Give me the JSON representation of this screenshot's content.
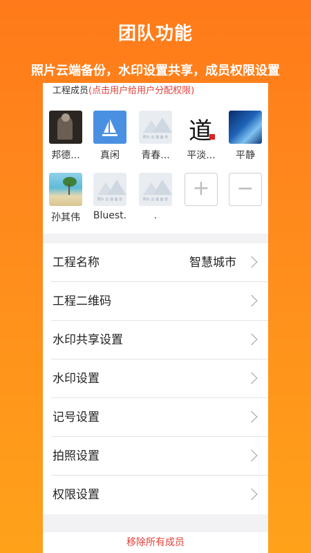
{
  "hero": {
    "title": "团队功能",
    "subtitle": "照片云端备份，水印设置共享，成员权限设置"
  },
  "members_section": {
    "label": "工程成员",
    "hint": "(点击用户给用户分配权限)"
  },
  "members": [
    {
      "name": "邦德...",
      "avatar": "dark-photo"
    },
    {
      "name": "真闲",
      "avatar": "sailboat-icon"
    },
    {
      "name": "青春...",
      "avatar": "placeholder-image"
    },
    {
      "name": "平淡...",
      "avatar": "calligraphy-image"
    },
    {
      "name": "平静",
      "avatar": "wave-photo"
    },
    {
      "name": "孙其伟",
      "avatar": "beach-photo"
    },
    {
      "name": "Bluest.",
      "avatar": "placeholder-image"
    },
    {
      "name": ".",
      "avatar": "placeholder-image"
    }
  ],
  "member_actions": {
    "add": "+",
    "remove": "−"
  },
  "placeholder_caption": "照片 云 端 备 份",
  "calligraphy_char": "道",
  "settings": [
    {
      "label": "工程名称",
      "value": "智慧城市"
    },
    {
      "label": "工程二维码",
      "value": ""
    },
    {
      "label": "水印共享设置",
      "value": ""
    },
    {
      "label": "水印设置",
      "value": ""
    },
    {
      "label": "记号设置",
      "value": ""
    },
    {
      "label": "拍照设置",
      "value": ""
    },
    {
      "label": "权限设置",
      "value": ""
    }
  ],
  "remove_all": "移除所有成员",
  "colors": {
    "accent": "#ff8a1c",
    "danger": "#e0403a",
    "boat": "#4a90e2"
  }
}
